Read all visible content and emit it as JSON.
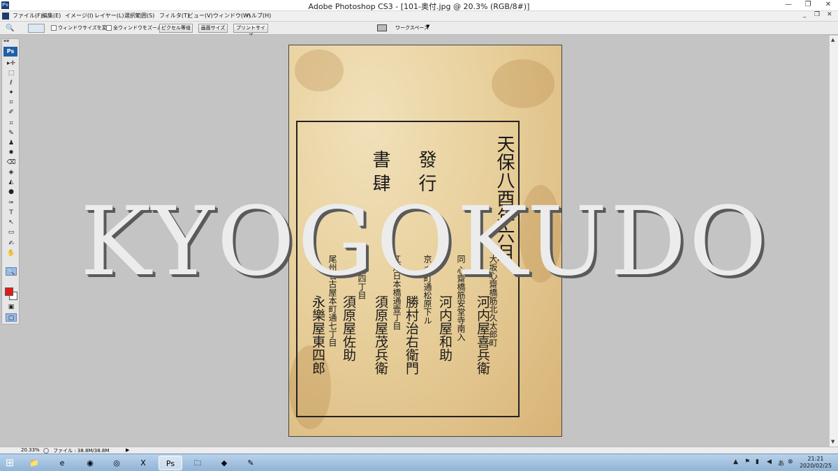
{
  "window": {
    "app_icon": "Ps",
    "title": "Adobe Photoshop CS3 - [101-奥付.jpg @ 20.3% (RGB/8#)]",
    "controls": {
      "minimize": "—",
      "maximize": "❐",
      "close": "✕"
    }
  },
  "menu": {
    "items": [
      "ファイル(F)",
      "編集(E)",
      "イメージ(I)",
      "レイヤー(L)",
      "選択範囲(S)",
      "フィルタ(T)",
      "ビュー(V)",
      "ウィンドウ(W)",
      "ヘルプ(H)"
    ],
    "doc_controls": {
      "minimize": "_",
      "restore": "❐",
      "close": "✕"
    }
  },
  "options": {
    "tool_icon": "🔍",
    "checkbox_resize": "ウィンドウサイズを変更",
    "checkbox_zoom_all": "全ウィンドウをズーム",
    "btn_actual_pixels": "ピクセル等倍",
    "btn_fit_screen": "画面サイズ",
    "btn_print_size": "プリントサイズ",
    "workspace_label": "ワークスペース"
  },
  "toolbox": {
    "logo": "Ps",
    "tools": [
      "▸✛",
      "⬚",
      "ℓ",
      "✦",
      "⌗",
      "✐",
      "⌗",
      "✎",
      "♟",
      "✸",
      "⌫",
      "◈",
      "◭",
      "●",
      "✑",
      "T",
      "↖",
      "▭",
      "✍",
      "✋",
      "🔍"
    ]
  },
  "document": {
    "col_date": "天保八酉年六月",
    "col_publisher_heading": "發 行",
    "col_shoshi": "書 肆",
    "col_1": "大坂心齋橋筋北久太郎町",
    "col_1b": "河内屋喜兵衛",
    "col_2": "同 心齋橋筋安堂寺南入",
    "col_2b": "河内屋和助",
    "col_3": "京 寺町通松原下ル",
    "col_3b": "勝村治右衛門",
    "col_4": "江戸日本橋通壹丁目",
    "col_4b": "須原屋茂兵衛",
    "col_5": "同 通四丁目",
    "col_5b": "須原屋佐助",
    "col_6": "尾州名古屋本町通七丁目",
    "col_6b": "永樂屋東四郎"
  },
  "watermark": "KYOGOKUDO",
  "status": {
    "zoom": "20.33%",
    "file_info": "ファイル : 38.8M/38.8M"
  },
  "taskbar": {
    "start_icon": "windows-logo",
    "apps": [
      "folder",
      "internet-explorer",
      "chrome",
      "chrome-alt",
      "excel",
      "photoshop",
      "folder2",
      "app3",
      "paint"
    ],
    "clock_time": "21:21",
    "clock_date": "2020/02/25"
  }
}
